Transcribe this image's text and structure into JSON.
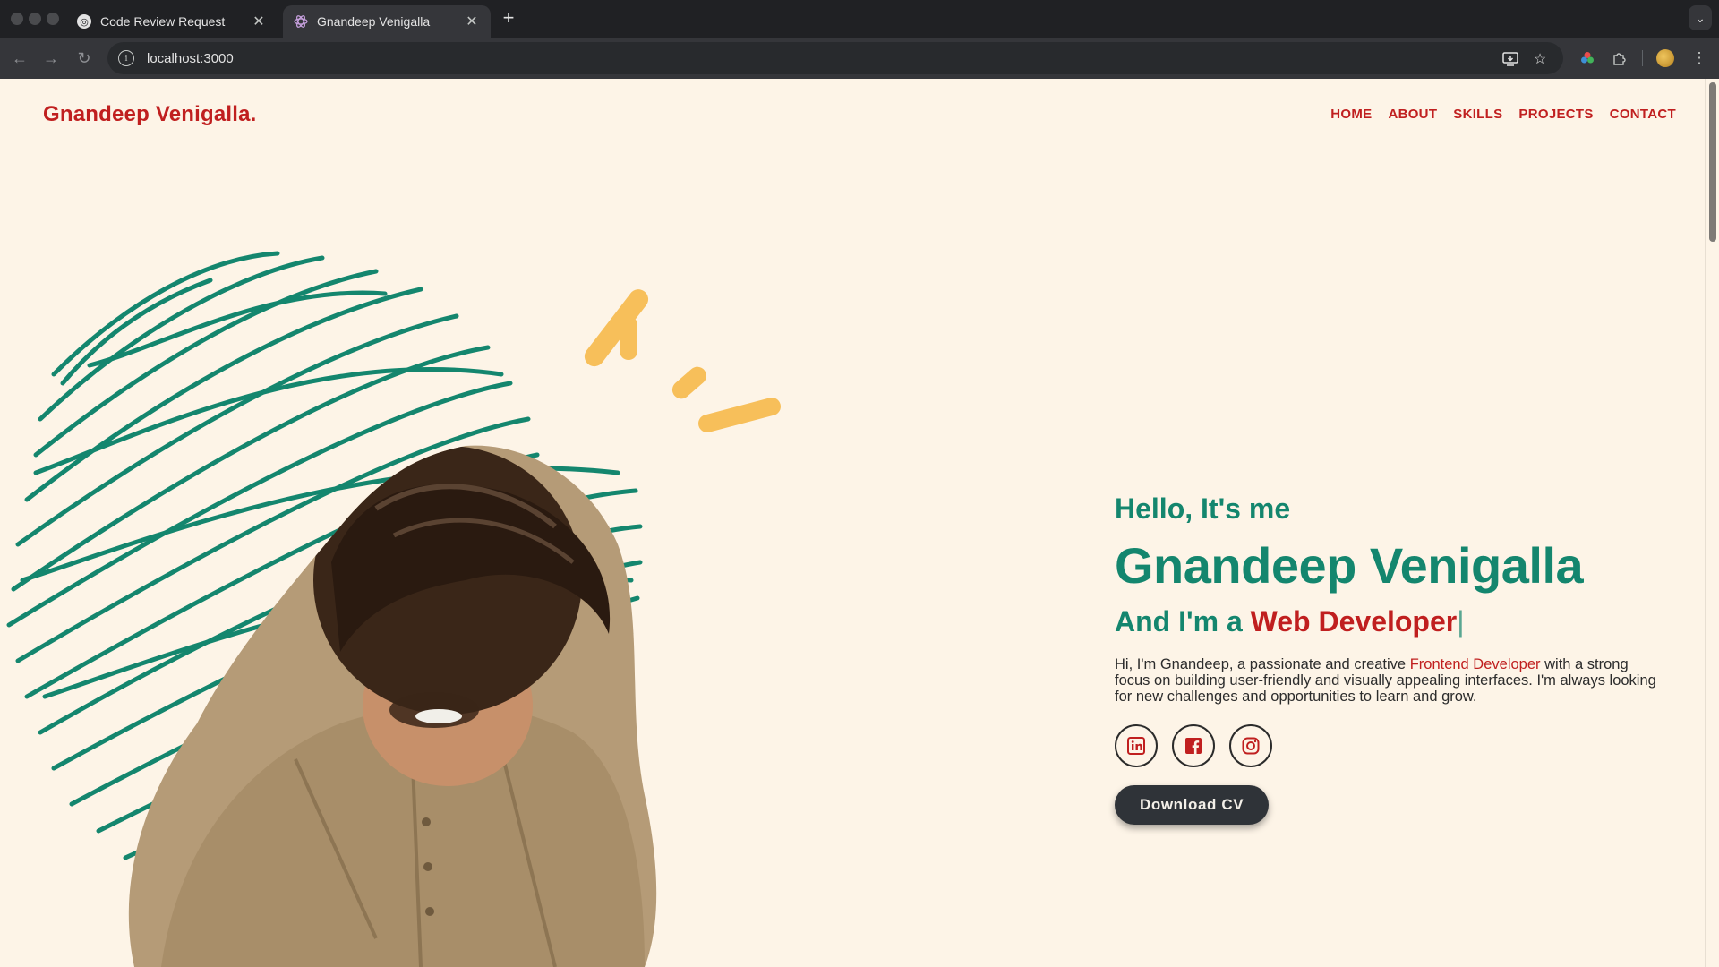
{
  "browser": {
    "tabs": [
      {
        "title": "Code Review Request",
        "active": false,
        "favicon": "openai-icon"
      },
      {
        "title": "Gnandeep Venigalla",
        "active": true,
        "favicon": "react-icon"
      }
    ],
    "url": "localhost:3000"
  },
  "header": {
    "logo": "Gnandeep Venigalla.",
    "nav": [
      "HOME",
      "ABOUT",
      "SKILLS",
      "PROJECTS",
      "CONTACT"
    ]
  },
  "hero": {
    "greeting": "Hello, It's me",
    "name": "Gnandeep Venigalla",
    "role_prefix": "And I'm a ",
    "role": "Web Developer",
    "cursor": "|",
    "bio_before": "Hi, I'm Gnandeep, a passionate and creative ",
    "bio_highlight": "Frontend Developer",
    "bio_after": " with a strong focus on building user-friendly and visually appealing interfaces. I'm always looking for new challenges and opportunities to learn and grow.",
    "socials": [
      "linkedin-icon",
      "facebook-icon",
      "instagram-icon"
    ],
    "cta": "Download CV"
  },
  "colors": {
    "background": "#fdf4e7",
    "brand_red": "#c01f1f",
    "brand_green": "#14866e",
    "accent_yellow": "#f7bf5a",
    "button_dark": "#2f3338"
  }
}
